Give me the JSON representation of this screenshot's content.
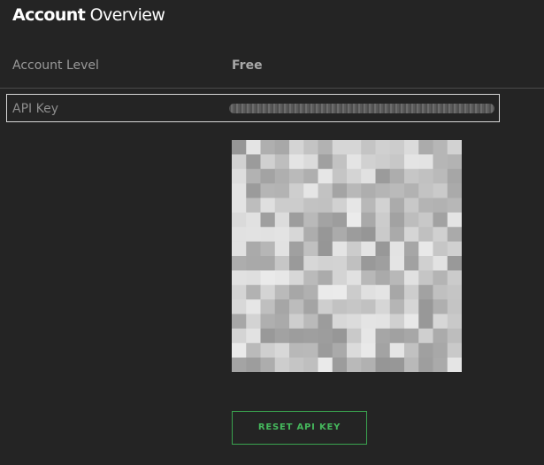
{
  "header": {
    "title_bold": "Account",
    "title_light": " Overview"
  },
  "account": {
    "level_label": "Account Level",
    "level_value": "Free"
  },
  "api": {
    "key_label": "API Key",
    "key_value": "••••••••••••••••••••••••••••••••"
  },
  "qr_code": {
    "icon": "qr-code-icon",
    "grid_size": 16,
    "pattern_seed": 7
  },
  "actions": {
    "reset_label": "RESET API KEY"
  },
  "colors": {
    "background": "#242424",
    "title": "#ffffff",
    "label": "#9a9a9a",
    "accent_green": "#45b85c",
    "highlight_border": "#d7d7d7"
  }
}
